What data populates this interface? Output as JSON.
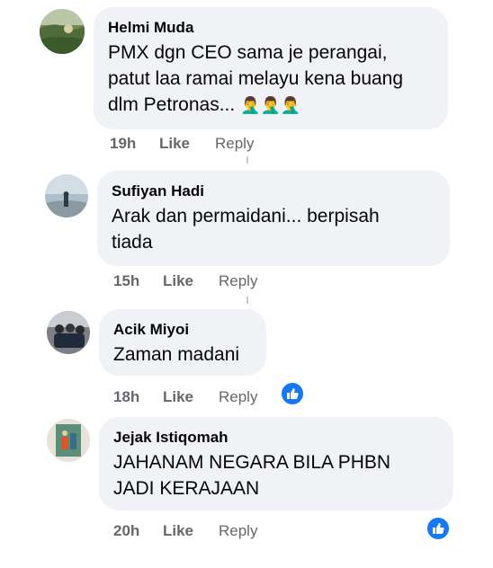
{
  "comments": [
    {
      "author": "Helmi Muda",
      "text": "PMX dgn CEO sama je perangai, patut laa ramai melayu kena buang dlm Petronas...",
      "emoji": "🤦‍♂️🤦‍♂️🤦‍♂️",
      "time": "19h",
      "like": "Like",
      "reply": "Reply"
    },
    {
      "author": "Sufiyan Hadi",
      "text": "Arak dan permaidani... berpisah tiada",
      "time": "15h",
      "like": "Like",
      "reply": "Reply"
    },
    {
      "author": "Acik Miyoi",
      "text": "Zaman madani",
      "time": "18h",
      "like": "Like",
      "reply": "Reply"
    },
    {
      "author": "Jejak Istiqomah",
      "text": "JAHANAM NEGARA BILA PHBN JADI KERAJAAN",
      "time": "20h",
      "like": "Like",
      "reply": "Reply"
    }
  ],
  "colors": {
    "bubble": "#f0f2f5",
    "meta": "#65676b",
    "like_reaction": "#1877f2"
  },
  "icons": [
    "like-reaction-icon"
  ]
}
